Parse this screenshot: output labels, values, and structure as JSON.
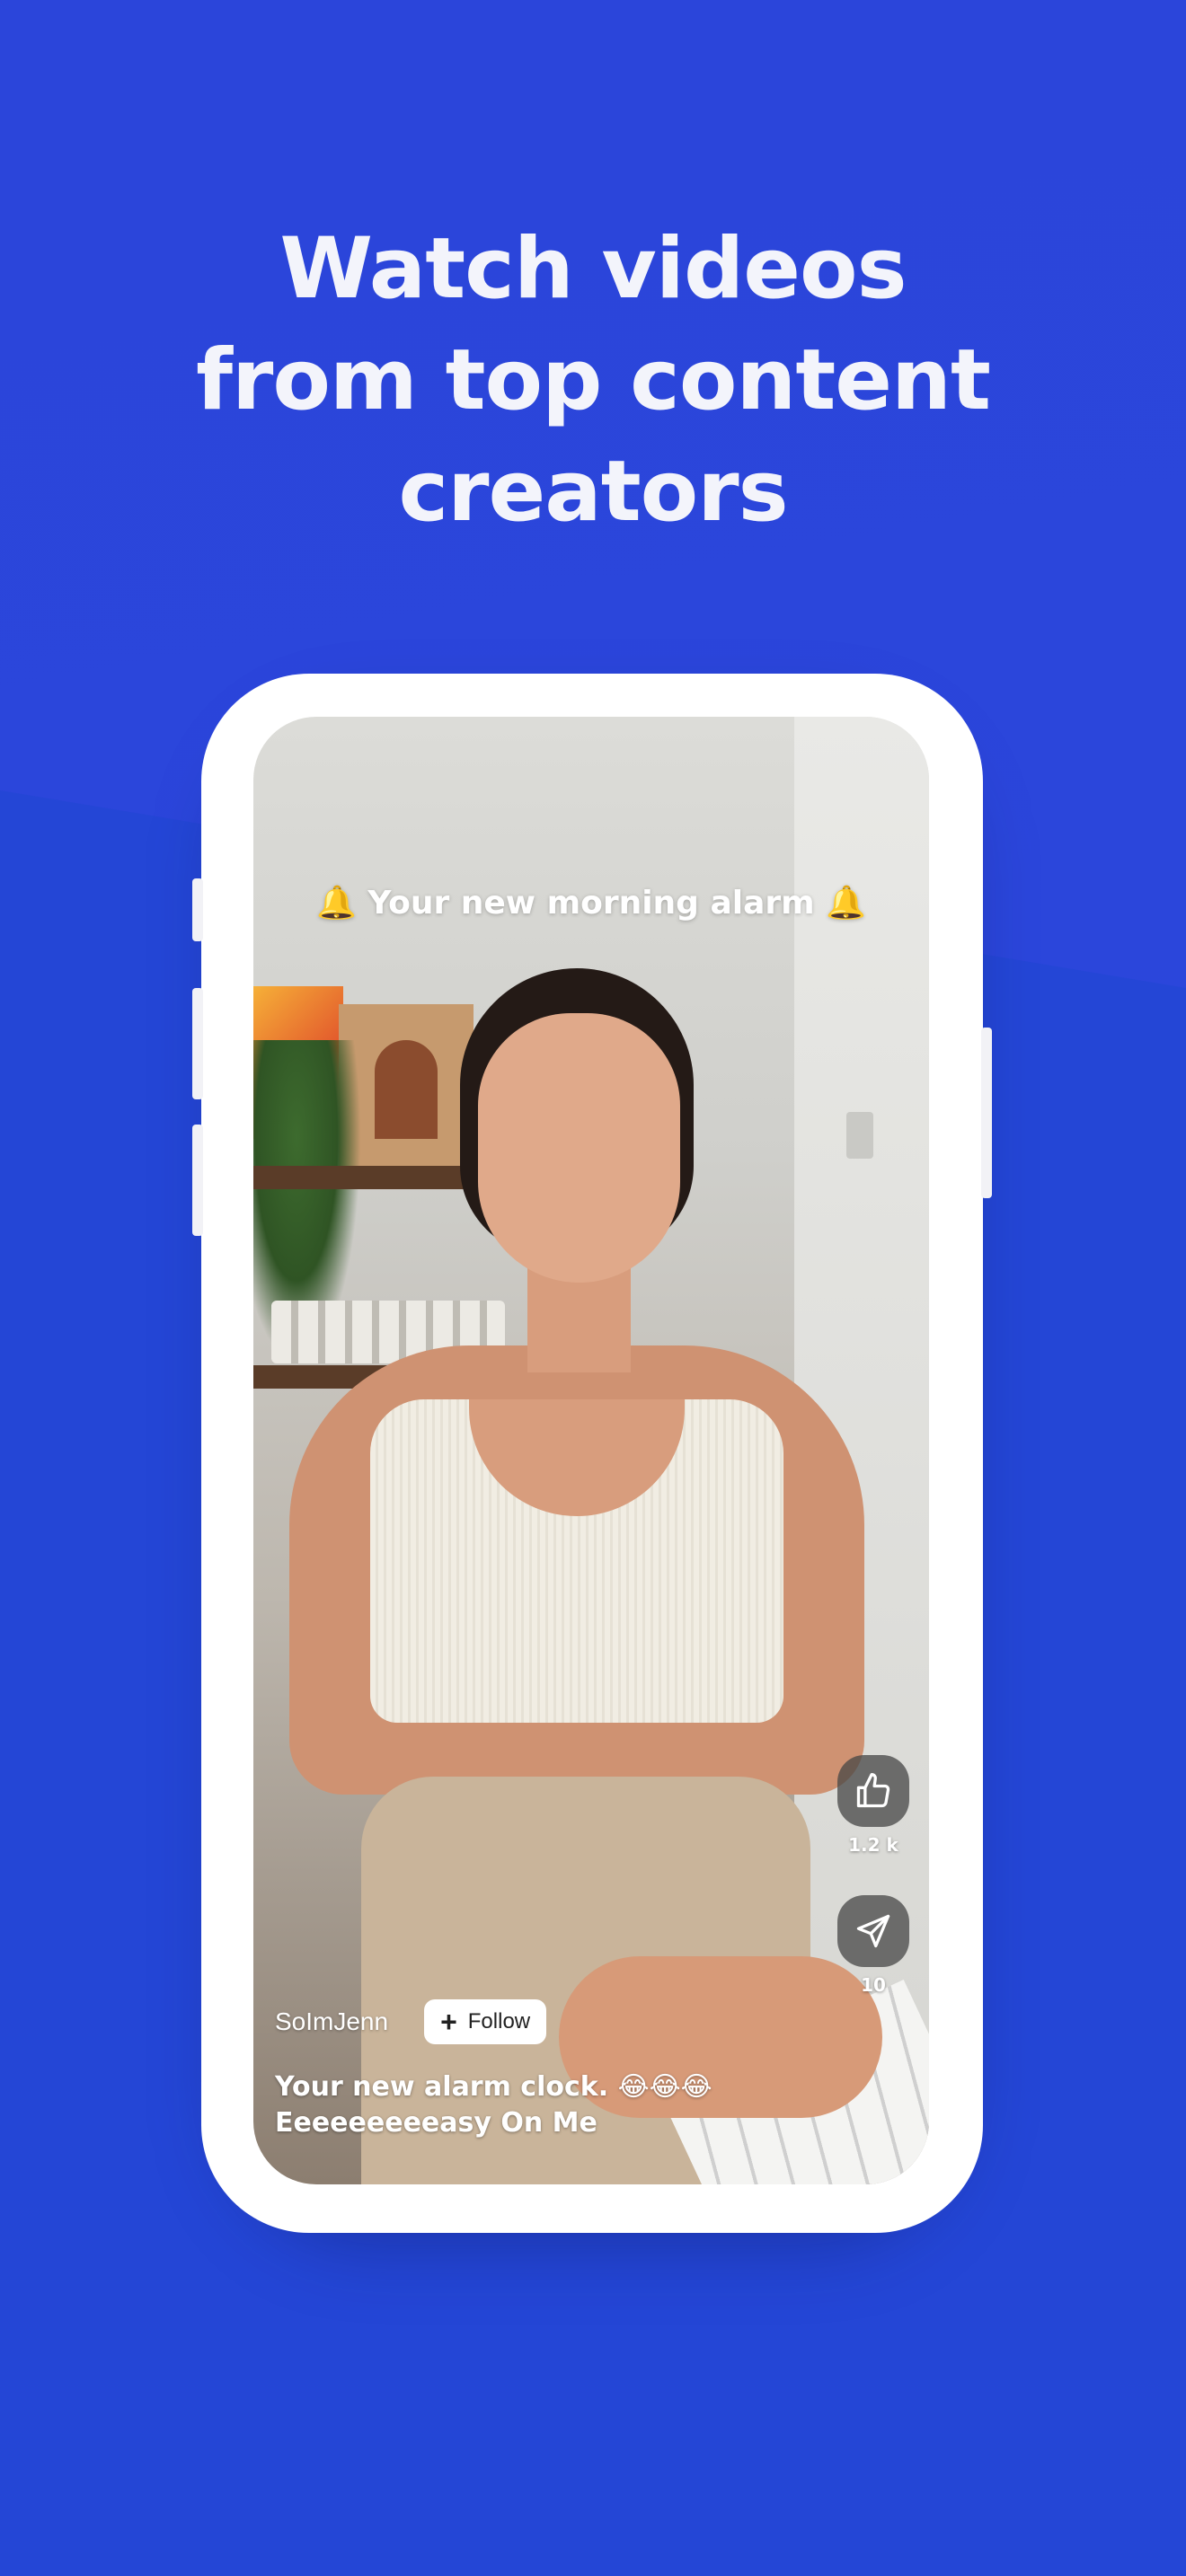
{
  "headline": {
    "line1": "Watch  videos",
    "line2": "from top content",
    "line3": "creators"
  },
  "video": {
    "overlay_caption": "Your new morning alarm",
    "bell_emoji": "🔔",
    "actions": {
      "like_count": "1.2 k",
      "share_count": "10"
    },
    "creator": {
      "name": "SoImJenn",
      "follow_label": "Follow"
    },
    "post": {
      "line1": "Your new alarm clock. 😂😂😂",
      "line2": "Eeeeeeeeeasy On Me"
    }
  },
  "colors": {
    "background": "#2a45d8",
    "headline_text": "#f3f4fb",
    "phone_frame": "#ffffff",
    "action_button_bg": "#464646"
  },
  "icons": [
    "thumbs-up-icon",
    "send-icon",
    "plus-icon",
    "bell-icon"
  ]
}
